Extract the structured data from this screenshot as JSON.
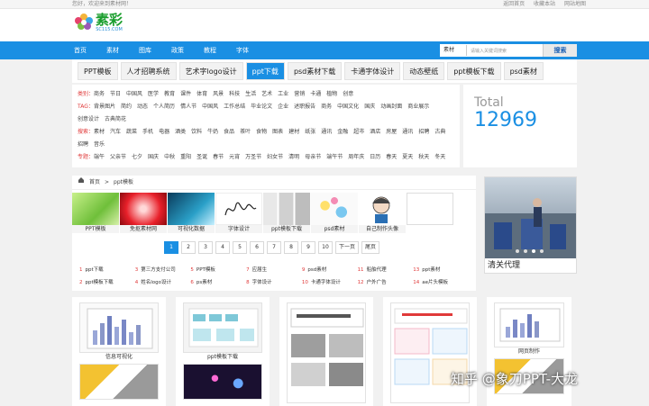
{
  "topbar": {
    "greeting": "您好，欢迎来到素材网！",
    "links": [
      "返回首页",
      "收藏本站",
      "网站地图"
    ]
  },
  "logo": {
    "name": "素彩",
    "sub": "SC115.COM"
  },
  "nav": {
    "items": [
      "首页",
      "素材",
      "图库",
      "政策",
      "教程",
      "字体"
    ]
  },
  "search": {
    "select": "素材",
    "placeholder": "请输入关键词搜索",
    "button": "搜索"
  },
  "tabs": [
    {
      "label": "PPT模板",
      "active": false
    },
    {
      "label": "人才招聘系统",
      "active": false
    },
    {
      "label": "艺术字logo设计",
      "active": false
    },
    {
      "label": "ppt下载",
      "active": true
    },
    {
      "label": "psd素材下载",
      "active": false
    },
    {
      "label": "卡通字体设计",
      "active": false
    },
    {
      "label": "动态壁纸",
      "active": false
    },
    {
      "label": "ppt模板下载",
      "active": false
    },
    {
      "label": "psd素材",
      "active": false
    }
  ],
  "categories": [
    {
      "head": "类别：",
      "items": [
        "商务",
        "节日",
        "中国风",
        "医学",
        "教育",
        "课件",
        "体育",
        "风景",
        "科技",
        "生活",
        "艺术",
        "工业",
        "营销",
        "卡通",
        "植物",
        "创意"
      ]
    },
    {
      "head": "TAG：",
      "items": [
        "背景图片",
        "简约",
        "动态",
        "个人简历",
        "情人节",
        "中国风",
        "工作总结",
        "毕业论文",
        "企业",
        "述职报告",
        "商务",
        "中国文化",
        "国庆",
        "动画封面",
        "商业展示",
        "创意设计",
        "古典简花"
      ]
    },
    {
      "head": "搜索：",
      "items": [
        "素材",
        "汽车",
        "蔬菜",
        "手机",
        "电器",
        "酒类",
        "饮料",
        "牛奶",
        "食品",
        "茶叶",
        "食物",
        "图表",
        "建材",
        "纸张",
        "通讯",
        "金融",
        "超市",
        "酒店",
        "房屋",
        "通讯",
        "招聘",
        "古典",
        "招聘",
        "音乐"
      ]
    },
    {
      "head": "专题：",
      "items": [
        "端午",
        "父亲节",
        "七夕",
        "国庆",
        "中秋",
        "重阳",
        "圣诞",
        "春节",
        "元宵",
        "万圣节",
        "妇女节",
        "清明",
        "母亲节",
        "端午节",
        "周年庆",
        "日历",
        "春天",
        "夏天",
        "秋天",
        "冬天"
      ]
    }
  ],
  "total": {
    "label": "Total",
    "value": "12969"
  },
  "breadcrumb": {
    "home": "首页",
    "sep": ">",
    "current": "ppt模板"
  },
  "thumbs": [
    {
      "caption": "PPT模板"
    },
    {
      "caption": "免抠素材网"
    },
    {
      "caption": "可视化数据"
    },
    {
      "caption": "字体设计"
    },
    {
      "caption": "ppt模板下载"
    },
    {
      "caption": "psd素材"
    },
    {
      "caption": "自己制作头像"
    },
    {
      "caption": ""
    }
  ],
  "pager": [
    "1",
    "2",
    "3",
    "4",
    "5",
    "6",
    "7",
    "8",
    "9",
    "10",
    "下一页",
    "尾页"
  ],
  "ranks": [
    {
      "n": "1",
      "t": "ppt下载"
    },
    {
      "n": "3",
      "t": "第三方支付公司"
    },
    {
      "n": "5",
      "t": "PPT模板"
    },
    {
      "n": "7",
      "t": "应届生"
    },
    {
      "n": "9",
      "t": "psd素材"
    },
    {
      "n": "11",
      "t": "船舶代理"
    },
    {
      "n": "13",
      "t": "ppt素材"
    },
    {
      "n": "2",
      "t": "ppt模板下载"
    },
    {
      "n": "4",
      "t": "姓名logo设计"
    },
    {
      "n": "6",
      "t": "ps素材"
    },
    {
      "n": "8",
      "t": "字体设计"
    },
    {
      "n": "10",
      "t": "卡通字体设计"
    },
    {
      "n": "12",
      "t": "户外广告"
    },
    {
      "n": "14",
      "t": "ae片头模板"
    }
  ],
  "side": {
    "caption": "清关代理"
  },
  "grid": [
    {
      "caption": "信息可视化"
    },
    {
      "caption": "ppt模板下载"
    },
    {
      "caption": ""
    },
    {
      "caption": ""
    },
    {
      "caption": "网页制作"
    }
  ],
  "watermark": "知乎 @象刀PPT-大龙",
  "colors": {
    "accent": "#1a8fe3",
    "rank": "#e03a3a",
    "logo": "#1a9e2d"
  }
}
